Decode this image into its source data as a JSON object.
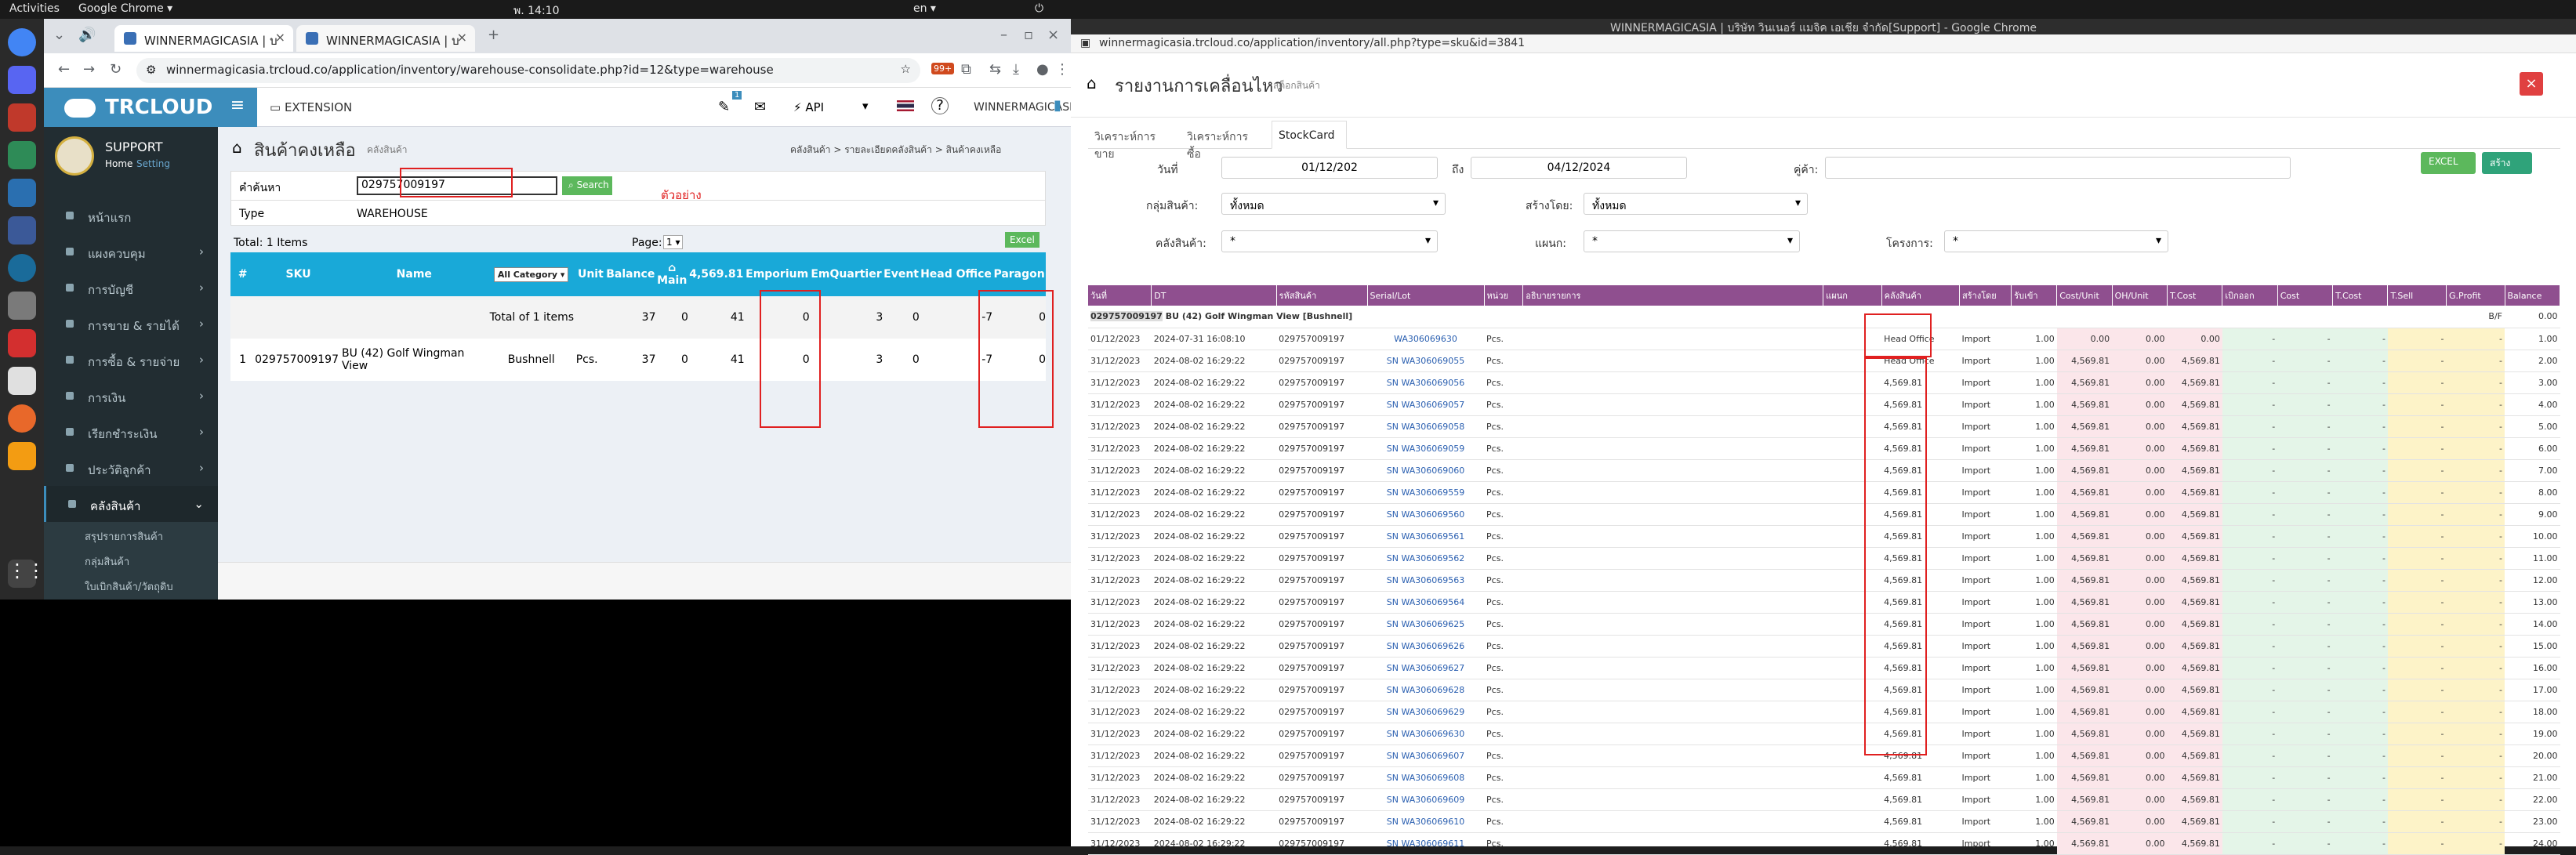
{
  "topbar": {
    "activities": "Activities",
    "app": "Google Chrome ▾",
    "clock": "พ. 14:10",
    "lang": "en ▾"
  },
  "left_browser": {
    "tabs": [
      {
        "title": "WINNERMAGICASIA | บ"
      },
      {
        "title": "WINNERMAGICASIA | บ"
      }
    ],
    "url": "winnermagicasia.trcloud.co/application/inventory/warehouse-consolidate.php?id=12&type=warehouse",
    "ext_badge": "99+"
  },
  "app": {
    "brand": "TRCLOUD",
    "profile": {
      "name": "SUPPORT",
      "home": "Home",
      "setting": "Setting"
    },
    "header_links": {
      "extension": "EXTENSION",
      "api": "API",
      "company": "WINNERMAGICASIA",
      "notif": "1"
    },
    "menu": [
      "หน้าแรก",
      "แผงควบคุม",
      "การบัญชี",
      "การขาย & รายได้",
      "การซื้อ & รายจ่าย",
      "การเงิน",
      "เรียกชำระเงิน",
      "ประวัติลูกค้า",
      "คลังสินค้า"
    ],
    "submenu": [
      "สรุปรายการสินค้า",
      "กลุ่มสินค้า",
      "ใบเบิกสินค้า/วัตถุดิบ"
    ]
  },
  "warehouse": {
    "title": "สินค้าคงเหลือ",
    "subtitle": "คลังสินค้า",
    "breadcrumb": [
      "คลังสินค้า",
      "รายละเอียดคลังสินค้า",
      "สินค้าคงเหลือ"
    ],
    "search_label": "คำค้นหา",
    "search_value": "029757009197",
    "search_button": "Search",
    "annotation": "ตัวอย่าง",
    "type_label": "Type",
    "type_value": "WAREHOUSE",
    "total": "Total: 1 Items",
    "page_label": "Page:",
    "page_value": "1",
    "excel": "Excel",
    "columns": [
      "#",
      "SKU",
      "Name",
      "All Category",
      "Unit",
      "Balance",
      "Main",
      "4,569.81",
      "Emporium",
      "EmQuartier",
      "Event",
      "Head Office",
      "Paragon"
    ],
    "total_row": {
      "label": "Total of 1 items",
      "balance": "37",
      "main": "0",
      "c4569": "41",
      "emporium": "0",
      "emquartier": "3",
      "event": "0",
      "head_office": "-7",
      "paragon": "0"
    },
    "row": {
      "no": "1",
      "sku": "029757009197",
      "name": "BU (42) Golf Wingman View",
      "category": "Bushnell",
      "unit": "Pcs.",
      "balance": "37",
      "main": "0",
      "c4569": "41",
      "emporium": "0",
      "emquartier": "3",
      "event": "0",
      "head_office": "-7",
      "paragon": "0"
    }
  },
  "right_browser": {
    "title": "WINNERMAGICASIA | บริษัท วินเนอร์ แมจิค เอเชีย จำกัด[Support] - Google Chrome",
    "url": "winnermagicasia.trcloud.co/application/inventory/all.php?type=sku&id=3841"
  },
  "stockcard": {
    "title": "รายงานการเคลื่อนไหว",
    "subtitle": "สต็อกสินค้า",
    "tabs": [
      "วิเคราะห์การขาย",
      "วิเคราะห์การซื้อ",
      "StockCard"
    ],
    "filters": {
      "date_label": "วันที่",
      "date_from": "01/12/202",
      "to_label": "ถึง",
      "date_to": "04/12/2024",
      "partner_label": "คู่ค้า:",
      "partner_value": "",
      "group_label": "กลุ่มสินค้า:",
      "group_value": "ทั้งหมด",
      "created_label": "สร้างโดย:",
      "created_value": "ทั้งหมด",
      "warehouse_label": "คลังสินค้า:",
      "warehouse_value": "*",
      "dept_label": "แผนก:",
      "dept_value": "*",
      "project_label": "โครงการ:",
      "project_value": "*",
      "excel": "EXCEL",
      "create": "สร้าง"
    },
    "columns": [
      "วันที่",
      "DT",
      "รหัสสินค้า",
      "Serial/Lot",
      "หน่วย",
      "อธิบายรายการ",
      "แผนก",
      "คลังสินค้า",
      "สร้างโดย",
      "รับเข้า",
      "Cost/Unit",
      "OH/Unit",
      "T.Cost",
      "เบิกออก",
      "Cost",
      "T.Cost",
      "T.Sell",
      "G.Profit",
      "Balance"
    ],
    "group_header": {
      "sku": "029757009197",
      "name": "BU (42) Golf Wingman View [Bushnell]",
      "bf": "B/F",
      "balance": "0.00"
    },
    "rows": [
      {
        "d": "01/12/2023",
        "dt": "2024-07-31 16:08:10",
        "sku": "029757009197",
        "serial": "WA306069630",
        "unit": "Pcs.",
        "wh": "Head Office",
        "by": "Import",
        "in": "1.00",
        "cu": "0.00",
        "oh": "0.00",
        "tc": "0.00",
        "bal": "1.00"
      },
      {
        "d": "31/12/2023",
        "dt": "2024-08-02 16:29:22",
        "sku": "029757009197",
        "serial": "SN WA306069055",
        "unit": "Pcs.",
        "wh": "Head Office",
        "by": "Import",
        "in": "1.00",
        "cu": "4,569.81",
        "oh": "0.00",
        "tc": "4,569.81",
        "bal": "2.00"
      },
      {
        "d": "31/12/2023",
        "dt": "2024-08-02 16:29:22",
        "sku": "029757009197",
        "serial": "SN WA306069056",
        "unit": "Pcs.",
        "wh": "4,569.81",
        "by": "Import",
        "in": "1.00",
        "cu": "4,569.81",
        "oh": "0.00",
        "tc": "4,569.81",
        "bal": "3.00"
      },
      {
        "d": "31/12/2023",
        "dt": "2024-08-02 16:29:22",
        "sku": "029757009197",
        "serial": "SN WA306069057",
        "unit": "Pcs.",
        "wh": "4,569.81",
        "by": "Import",
        "in": "1.00",
        "cu": "4,569.81",
        "oh": "0.00",
        "tc": "4,569.81",
        "bal": "4.00"
      },
      {
        "d": "31/12/2023",
        "dt": "2024-08-02 16:29:22",
        "sku": "029757009197",
        "serial": "SN WA306069058",
        "unit": "Pcs.",
        "wh": "4,569.81",
        "by": "Import",
        "in": "1.00",
        "cu": "4,569.81",
        "oh": "0.00",
        "tc": "4,569.81",
        "bal": "5.00"
      },
      {
        "d": "31/12/2023",
        "dt": "2024-08-02 16:29:22",
        "sku": "029757009197",
        "serial": "SN WA306069059",
        "unit": "Pcs.",
        "wh": "4,569.81",
        "by": "Import",
        "in": "1.00",
        "cu": "4,569.81",
        "oh": "0.00",
        "tc": "4,569.81",
        "bal": "6.00"
      },
      {
        "d": "31/12/2023",
        "dt": "2024-08-02 16:29:22",
        "sku": "029757009197",
        "serial": "SN WA306069060",
        "unit": "Pcs.",
        "wh": "4,569.81",
        "by": "Import",
        "in": "1.00",
        "cu": "4,569.81",
        "oh": "0.00",
        "tc": "4,569.81",
        "bal": "7.00"
      },
      {
        "d": "31/12/2023",
        "dt": "2024-08-02 16:29:22",
        "sku": "029757009197",
        "serial": "SN WA306069559",
        "unit": "Pcs.",
        "wh": "4,569.81",
        "by": "Import",
        "in": "1.00",
        "cu": "4,569.81",
        "oh": "0.00",
        "tc": "4,569.81",
        "bal": "8.00"
      },
      {
        "d": "31/12/2023",
        "dt": "2024-08-02 16:29:22",
        "sku": "029757009197",
        "serial": "SN WA306069560",
        "unit": "Pcs.",
        "wh": "4,569.81",
        "by": "Import",
        "in": "1.00",
        "cu": "4,569.81",
        "oh": "0.00",
        "tc": "4,569.81",
        "bal": "9.00"
      },
      {
        "d": "31/12/2023",
        "dt": "2024-08-02 16:29:22",
        "sku": "029757009197",
        "serial": "SN WA306069561",
        "unit": "Pcs.",
        "wh": "4,569.81",
        "by": "Import",
        "in": "1.00",
        "cu": "4,569.81",
        "oh": "0.00",
        "tc": "4,569.81",
        "bal": "10.00"
      },
      {
        "d": "31/12/2023",
        "dt": "2024-08-02 16:29:22",
        "sku": "029757009197",
        "serial": "SN WA306069562",
        "unit": "Pcs.",
        "wh": "4,569.81",
        "by": "Import",
        "in": "1.00",
        "cu": "4,569.81",
        "oh": "0.00",
        "tc": "4,569.81",
        "bal": "11.00"
      },
      {
        "d": "31/12/2023",
        "dt": "2024-08-02 16:29:22",
        "sku": "029757009197",
        "serial": "SN WA306069563",
        "unit": "Pcs.",
        "wh": "4,569.81",
        "by": "Import",
        "in": "1.00",
        "cu": "4,569.81",
        "oh": "0.00",
        "tc": "4,569.81",
        "bal": "12.00"
      },
      {
        "d": "31/12/2023",
        "dt": "2024-08-02 16:29:22",
        "sku": "029757009197",
        "serial": "SN WA306069564",
        "unit": "Pcs.",
        "wh": "4,569.81",
        "by": "Import",
        "in": "1.00",
        "cu": "4,569.81",
        "oh": "0.00",
        "tc": "4,569.81",
        "bal": "13.00"
      },
      {
        "d": "31/12/2023",
        "dt": "2024-08-02 16:29:22",
        "sku": "029757009197",
        "serial": "SN WA306069625",
        "unit": "Pcs.",
        "wh": "4,569.81",
        "by": "Import",
        "in": "1.00",
        "cu": "4,569.81",
        "oh": "0.00",
        "tc": "4,569.81",
        "bal": "14.00"
      },
      {
        "d": "31/12/2023",
        "dt": "2024-08-02 16:29:22",
        "sku": "029757009197",
        "serial": "SN WA306069626",
        "unit": "Pcs.",
        "wh": "4,569.81",
        "by": "Import",
        "in": "1.00",
        "cu": "4,569.81",
        "oh": "0.00",
        "tc": "4,569.81",
        "bal": "15.00"
      },
      {
        "d": "31/12/2023",
        "dt": "2024-08-02 16:29:22",
        "sku": "029757009197",
        "serial": "SN WA306069627",
        "unit": "Pcs.",
        "wh": "4,569.81",
        "by": "Import",
        "in": "1.00",
        "cu": "4,569.81",
        "oh": "0.00",
        "tc": "4,569.81",
        "bal": "16.00"
      },
      {
        "d": "31/12/2023",
        "dt": "2024-08-02 16:29:22",
        "sku": "029757009197",
        "serial": "SN WA306069628",
        "unit": "Pcs.",
        "wh": "4,569.81",
        "by": "Import",
        "in": "1.00",
        "cu": "4,569.81",
        "oh": "0.00",
        "tc": "4,569.81",
        "bal": "17.00"
      },
      {
        "d": "31/12/2023",
        "dt": "2024-08-02 16:29:22",
        "sku": "029757009197",
        "serial": "SN WA306069629",
        "unit": "Pcs.",
        "wh": "4,569.81",
        "by": "Import",
        "in": "1.00",
        "cu": "4,569.81",
        "oh": "0.00",
        "tc": "4,569.81",
        "bal": "18.00"
      },
      {
        "d": "31/12/2023",
        "dt": "2024-08-02 16:29:22",
        "sku": "029757009197",
        "serial": "SN WA306069630",
        "unit": "Pcs.",
        "wh": "4,569.81",
        "by": "Import",
        "in": "1.00",
        "cu": "4,569.81",
        "oh": "0.00",
        "tc": "4,569.81",
        "bal": "19.00"
      },
      {
        "d": "31/12/2023",
        "dt": "2024-08-02 16:29:22",
        "sku": "029757009197",
        "serial": "SN WA306069607",
        "unit": "Pcs.",
        "wh": "4,569.81",
        "by": "Import",
        "in": "1.00",
        "cu": "4,569.81",
        "oh": "0.00",
        "tc": "4,569.81",
        "bal": "20.00"
      },
      {
        "d": "31/12/2023",
        "dt": "2024-08-02 16:29:22",
        "sku": "029757009197",
        "serial": "SN WA306069608",
        "unit": "Pcs.",
        "wh": "4,569.81",
        "by": "Import",
        "in": "1.00",
        "cu": "4,569.81",
        "oh": "0.00",
        "tc": "4,569.81",
        "bal": "21.00"
      },
      {
        "d": "31/12/2023",
        "dt": "2024-08-02 16:29:22",
        "sku": "029757009197",
        "serial": "SN WA306069609",
        "unit": "Pcs.",
        "wh": "4,569.81",
        "by": "Import",
        "in": "1.00",
        "cu": "4,569.81",
        "oh": "0.00",
        "tc": "4,569.81",
        "bal": "22.00"
      },
      {
        "d": "31/12/2023",
        "dt": "2024-08-02 16:29:22",
        "sku": "029757009197",
        "serial": "SN WA306069610",
        "unit": "Pcs.",
        "wh": "4,569.81",
        "by": "Import",
        "in": "1.00",
        "cu": "4,569.81",
        "oh": "0.00",
        "tc": "4,569.81",
        "bal": "23.00"
      },
      {
        "d": "31/12/2023",
        "dt": "2024-08-02 16:29:22",
        "sku": "029757009197",
        "serial": "SN WA306069611",
        "unit": "Pcs.",
        "wh": "4,569.81",
        "by": "Import",
        "in": "1.00",
        "cu": "4,569.81",
        "oh": "0.00",
        "tc": "4,569.81",
        "bal": "24.00"
      }
    ],
    "dash": "-"
  },
  "colors": {
    "accent": "#3c8dbc",
    "sidebar": "#222d32",
    "table_head": "#8f4f8f",
    "annot": "#e02020",
    "green": "#5cb85c"
  }
}
